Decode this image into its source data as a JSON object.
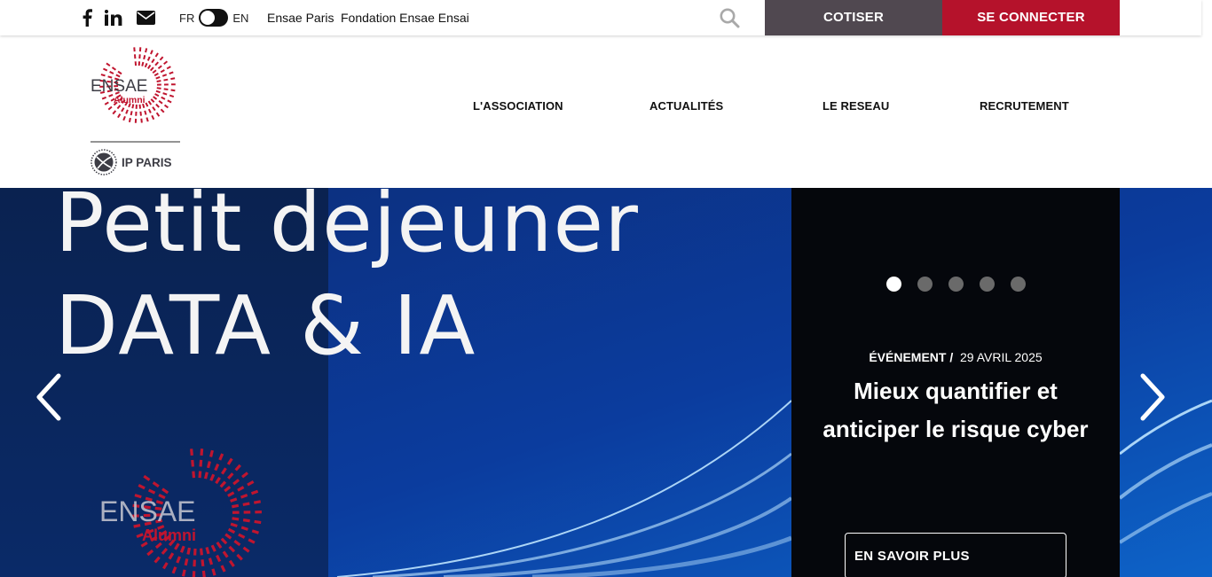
{
  "topbar": {
    "icons": [
      "facebook-icon",
      "linkedin-icon",
      "envelope-icon",
      "search-icon"
    ],
    "lang_fr": "FR",
    "lang_en": "EN",
    "link_ensae_paris": "Ensae Paris",
    "link_fondation": "Fondation Ensae Ensai",
    "cotiser_label": "COTISER",
    "connect_label": "SE CONNECTER"
  },
  "logo": {
    "name": "ENSAE",
    "sub": "Alumni",
    "partner": "IP PARIS"
  },
  "nav": {
    "items": [
      "L'ASSOCIATION",
      "ACTUALITÉS",
      "LE RESEAU",
      "RECRUTEMENT"
    ]
  },
  "hero": {
    "image_line1": "Petit dejeuner",
    "image_line2": "DATA & IA",
    "image_logo_name": "ENSAE",
    "image_logo_sub": "Alumni",
    "slide_count": 5,
    "active_slide": 1,
    "category": "ÉVÉNEMENT /",
    "date": "29 AVRIL 2025",
    "title": "Mieux quantifier et anticiper le risque cyber",
    "cta_label": "EN SAVOIR PLUS"
  },
  "colors": {
    "cotiser_bg": "#504850",
    "connect_bg": "#b5122b",
    "brand_red": "#c0152f",
    "panel_bg": "#05070c",
    "hero_blue": "#0b2a6e"
  }
}
